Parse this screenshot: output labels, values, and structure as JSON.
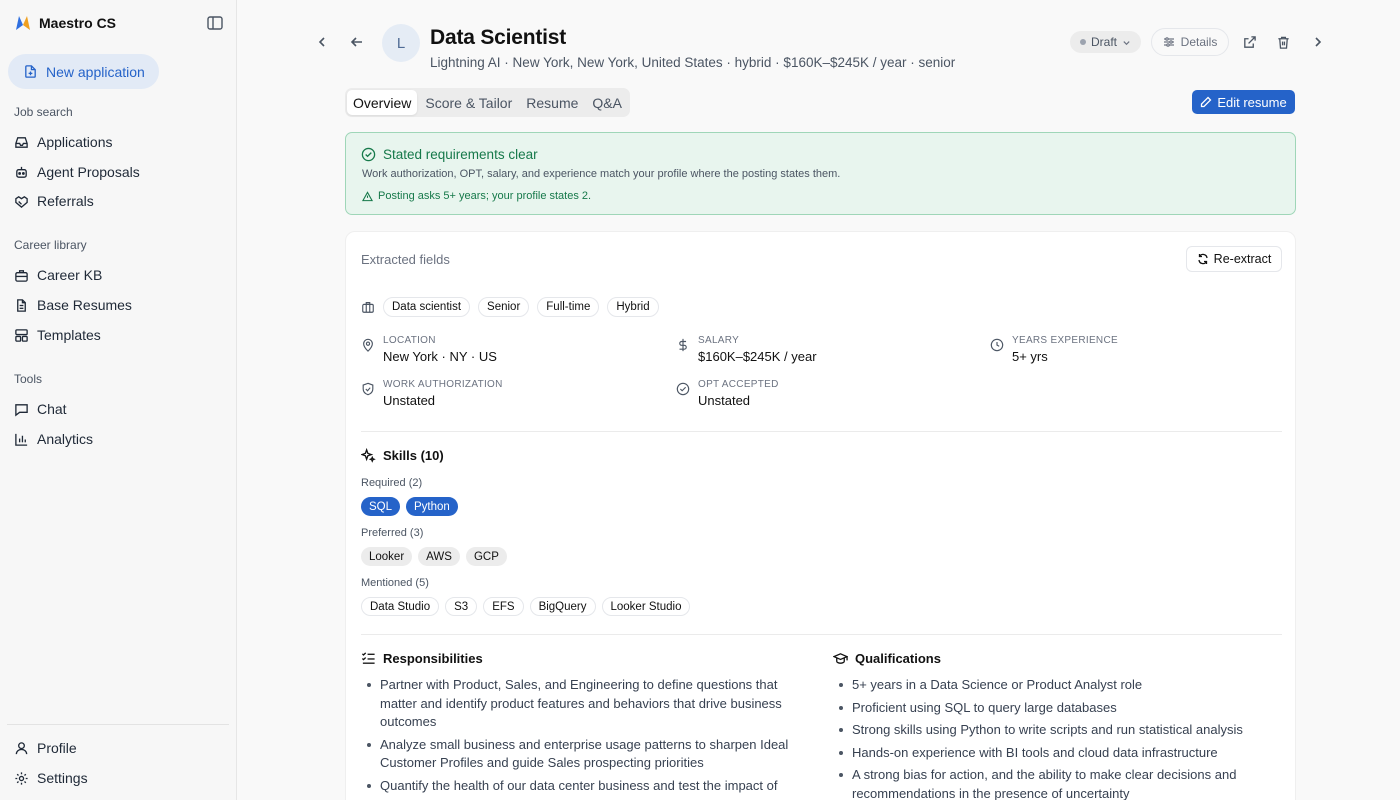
{
  "app": {
    "name": "Maestro CS"
  },
  "sidebar": {
    "new_application": "New application",
    "sections": {
      "job_search": "Job search",
      "career_library": "Career library",
      "tools": "Tools"
    },
    "items": {
      "applications": "Applications",
      "agent_proposals": "Agent Proposals",
      "referrals": "Referrals",
      "career_kb": "Career KB",
      "base_resumes": "Base Resumes",
      "templates": "Templates",
      "chat": "Chat",
      "analytics": "Analytics",
      "profile": "Profile",
      "settings": "Settings"
    }
  },
  "header": {
    "avatar_letter": "L",
    "title": "Data Scientist",
    "subtitle": "Lightning AI · New York, New York, United States · hybrid · $160K–$245K / year · senior",
    "status": "Draft",
    "details": "Details"
  },
  "tabs": [
    "Overview",
    "Score & Tailor",
    "Resume",
    "Q&A"
  ],
  "edit_resume": "Edit resume",
  "alert": {
    "title": "Stated requirements clear",
    "body": "Work authorization, OPT, salary, and experience match your profile where the posting states them.",
    "warning": "Posting asks 5+ years; your profile states 2."
  },
  "extracted": {
    "heading": "Extracted fields",
    "reextract": "Re-extract",
    "tags": [
      "Data scientist",
      "Senior",
      "Full-time",
      "Hybrid"
    ],
    "fields": {
      "location": {
        "label": "LOCATION",
        "value": "New York · NY · US"
      },
      "salary": {
        "label": "SALARY",
        "value": "$160K–$245K / year"
      },
      "years": {
        "label": "YEARS EXPERIENCE",
        "value": "5+ yrs"
      },
      "work_auth": {
        "label": "WORK AUTHORIZATION",
        "value": "Unstated"
      },
      "opt": {
        "label": "OPT ACCEPTED",
        "value": "Unstated"
      }
    }
  },
  "skills": {
    "title": "Skills (10)",
    "required_label": "Required (2)",
    "required": [
      "SQL",
      "Python"
    ],
    "preferred_label": "Preferred (3)",
    "preferred": [
      "Looker",
      "AWS",
      "GCP"
    ],
    "mentioned_label": "Mentioned (5)",
    "mentioned": [
      "Data Studio",
      "S3",
      "EFS",
      "BigQuery",
      "Looker Studio"
    ]
  },
  "responsibilities": {
    "title": "Responsibilities",
    "items": [
      "Partner with Product, Sales, and Engineering to define questions that matter and identify product features and behaviors that drive business outcomes",
      "Analyze small business and enterprise usage patterns to sharpen Ideal Customer Profiles and guide Sales prospecting priorities",
      "Quantify the health of our data center business and test the impact of"
    ]
  },
  "qualifications": {
    "title": "Qualifications",
    "items": [
      "5+ years in a Data Science or Product Analyst role",
      "Proficient using SQL to query large databases",
      "Strong skills using Python to write scripts and run statistical analysis",
      "Hands-on experience with BI tools and cloud data infrastructure",
      "A strong bias for action, and the ability to make clear decisions and recommendations in the presence of uncertainty"
    ]
  }
}
